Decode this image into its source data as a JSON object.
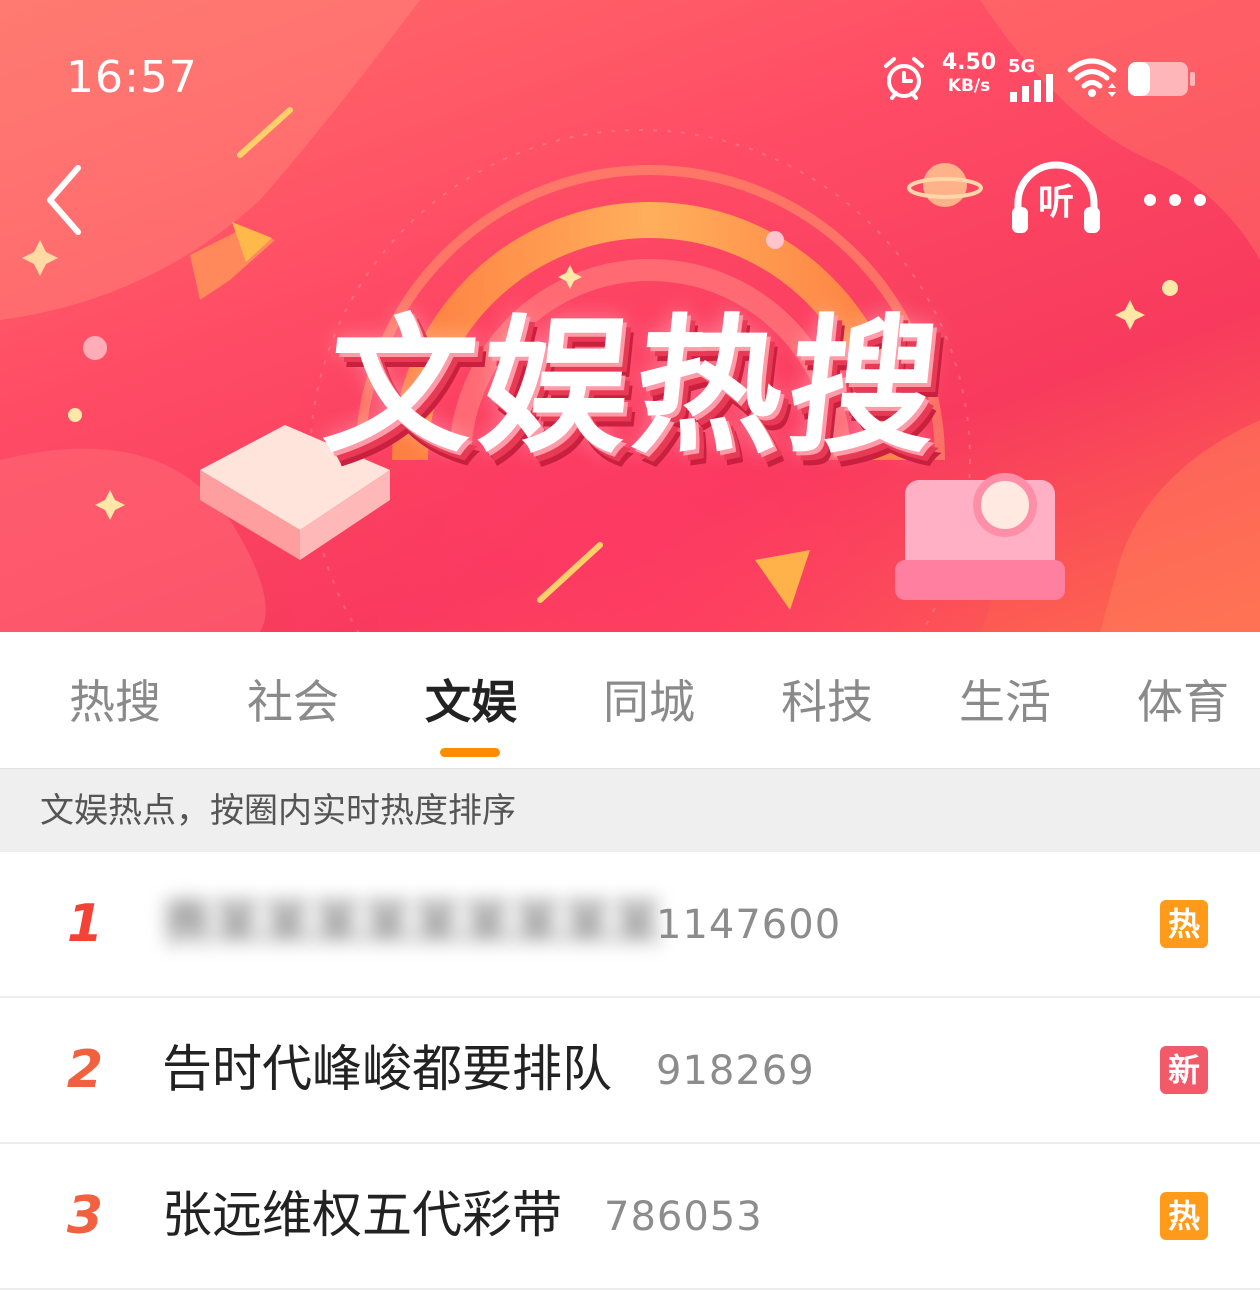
{
  "status_bar": {
    "time": "16:57",
    "net_speed_value": "4.50",
    "net_speed_unit": "KB/s",
    "network_type": "5G",
    "icons": [
      "alarm-icon",
      "signal-icon",
      "wifi-icon",
      "battery-icon"
    ]
  },
  "header": {
    "back_icon": "chevron-left-icon",
    "listen_label": "听",
    "more_icon": "more-dots-icon",
    "banner_title": "文娱热搜"
  },
  "tabs": [
    {
      "label": "热搜",
      "active": false
    },
    {
      "label": "社会",
      "active": false
    },
    {
      "label": "文娱",
      "active": true
    },
    {
      "label": "同城",
      "active": false
    },
    {
      "label": "科技",
      "active": false
    },
    {
      "label": "生活",
      "active": false
    },
    {
      "label": "体育",
      "active": false
    }
  ],
  "subheader": "文娱热点，按圈内实时热度排序",
  "list": [
    {
      "rank": "1",
      "title": "赛某某某某某某某某某",
      "blurred": true,
      "count": "1147600",
      "badge": "热",
      "badge_type": "hot"
    },
    {
      "rank": "2",
      "title": "告时代峰峻都要排队",
      "blurred": false,
      "count": "918269",
      "badge": "新",
      "badge_type": "new"
    },
    {
      "rank": "3",
      "title": "张远维权五代彩带",
      "blurred": false,
      "count": "786053",
      "badge": "热",
      "badge_type": "hot"
    }
  ],
  "colors": {
    "accent": "#ff8c00",
    "hot_badge": "#ff9a1a",
    "new_badge": "#f25a6a",
    "rank": "#f2613f",
    "banner": "#ff4c65"
  }
}
